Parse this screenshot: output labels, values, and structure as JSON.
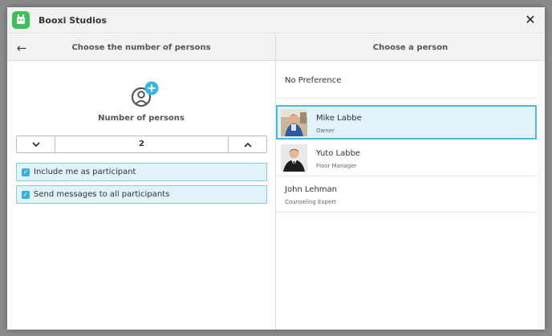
{
  "window": {
    "title": "Booxi Studios",
    "close_symbol": "✕"
  },
  "left": {
    "header_title": "Choose the number of persons",
    "back_symbol": "←",
    "persons_label": "Number of persons",
    "stepper": {
      "value": "2",
      "dec_symbol": "⌄",
      "inc_symbol": "⌃"
    },
    "options": [
      {
        "label": "Include me as participant",
        "checked": true
      },
      {
        "label": "Send messages to all participants",
        "checked": true
      }
    ],
    "check_symbol": "✓"
  },
  "right": {
    "header_title": "Choose a person",
    "no_preference": "No Preference",
    "persons": [
      {
        "name": "Mike Labbe",
        "role": "Owner",
        "selected": true,
        "has_photo": true
      },
      {
        "name": "Yuto Labbe",
        "role": "Floor Manager",
        "selected": false,
        "has_photo": true
      },
      {
        "name": "John Lehman",
        "role": "Counseling Expert",
        "selected": false,
        "has_photo": false
      }
    ]
  },
  "colors": {
    "accent": "#3aaed8",
    "selected_bg": "#dff3f9",
    "selected_border": "#4fb9dc",
    "logo_green": "#3fbf5a",
    "plus_badge": "#3ab4e0"
  },
  "icons": {
    "app_logo": "booxi-robot-logo",
    "persons": "add-person-icon"
  }
}
